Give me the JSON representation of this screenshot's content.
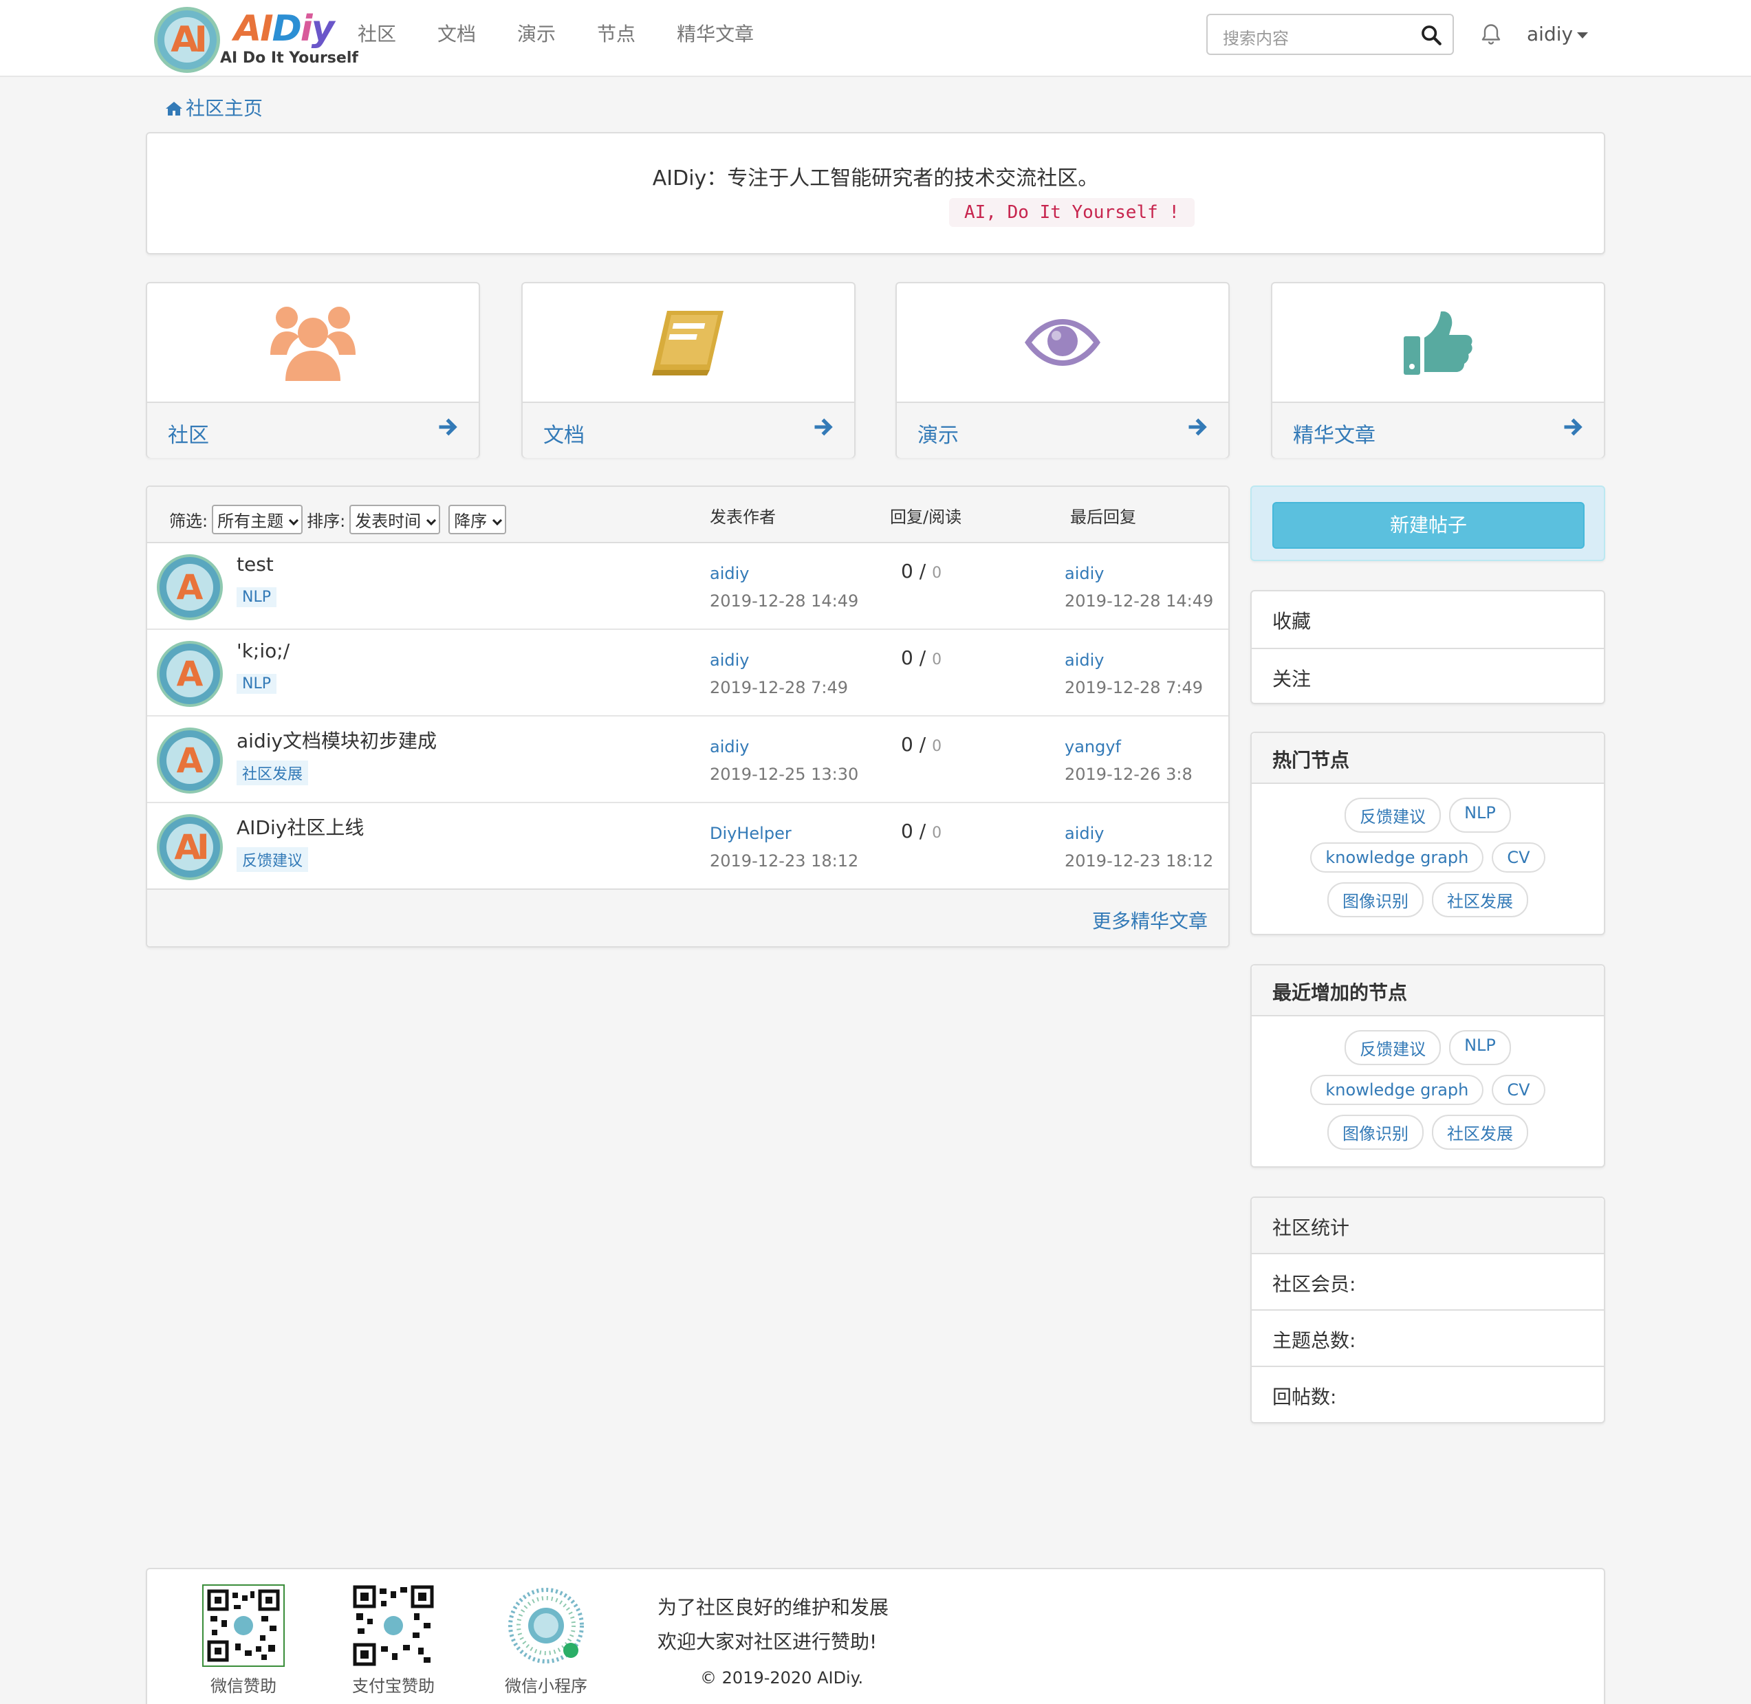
{
  "navbar": {
    "logo_letters": "AI",
    "logo_brand": {
      "a": "AI",
      "d": "D",
      "i": "i",
      "y": "y"
    },
    "logo_sub": "AI Do It Yourself",
    "items": [
      "社区",
      "文档",
      "演示",
      "节点",
      "精华文章"
    ],
    "search_placeholder": "搜索内容",
    "user": "aidiy"
  },
  "breadcrumb": {
    "label": "社区主页"
  },
  "intro": {
    "tagline": "AIDiy：专注于人工智能研究者的技术交流社区。",
    "code": "AI, Do It Yourself !"
  },
  "cards": [
    {
      "label": "社区",
      "icon": "users-icon",
      "color": "#f4a77a"
    },
    {
      "label": "文档",
      "icon": "book-icon",
      "color": "#d8ac3c"
    },
    {
      "label": "演示",
      "icon": "eye-icon",
      "color": "#9b84c0"
    },
    {
      "label": "精华文章",
      "icon": "thumbs-up-icon",
      "color": "#58aaa0"
    }
  ],
  "topic_table": {
    "filter_label": "筛选:",
    "filter_value": "所有主题",
    "sort_label": "排序:",
    "sort_value": "发表时间",
    "order_value": "降序",
    "col_author": "发表作者",
    "col_stats": "回复/阅读",
    "col_last": "最后回复",
    "rows": [
      {
        "title": "test",
        "tag": "NLP",
        "author": "aidiy",
        "time": "2019-12-28 14:49",
        "replies": "0",
        "reads": "0",
        "last_user": "aidiy",
        "last_time": "2019-12-28 14:49",
        "avatar": "A"
      },
      {
        "title": "'k;io;/",
        "tag": "NLP",
        "author": "aidiy",
        "time": "2019-12-28 7:49",
        "replies": "0",
        "reads": "0",
        "last_user": "aidiy",
        "last_time": "2019-12-28 7:49",
        "avatar": "A"
      },
      {
        "title": "aidiy文档模块初步建成",
        "tag": "社区发展",
        "author": "aidiy",
        "time": "2019-12-25 13:30",
        "replies": "0",
        "reads": "0",
        "last_user": "yangyf",
        "last_time": "2019-12-26 3:8",
        "avatar": "A"
      },
      {
        "title": "AIDiy社区上线",
        "tag": "反馈建议",
        "author": "DiyHelper",
        "time": "2019-12-23 18:12",
        "replies": "0",
        "reads": "0",
        "last_user": "aidiy",
        "last_time": "2019-12-23 18:12",
        "avatar": "AI"
      }
    ],
    "more_label": "更多精华文章"
  },
  "sidebar": {
    "new_post": "新建帖子",
    "links": [
      "收藏",
      "关注"
    ],
    "hot_nodes": {
      "title": "热门节点",
      "tags": [
        "反馈建议",
        "NLP",
        "knowledge graph",
        "CV",
        "图像识别",
        "社区发展"
      ]
    },
    "recent_nodes": {
      "title": "最近增加的节点",
      "tags": [
        "反馈建议",
        "NLP",
        "knowledge graph",
        "CV",
        "图像识别",
        "社区发展"
      ]
    },
    "stats": {
      "title": "社区统计",
      "members": "社区会员:",
      "topics": "主题总数:",
      "replies": "回帖数:"
    }
  },
  "footer": {
    "qr_labels": [
      "微信赞助",
      "支付宝赞助",
      "微信小程序"
    ],
    "msg1": "为了社区良好的维护和发展",
    "msg2": "欢迎大家对社区进行赞助!",
    "copyright": "© 2019-2020 AIDiy."
  },
  "colors": {
    "link": "#337ab7",
    "info": "#5bc0de",
    "tag_red": "#c7254e"
  }
}
